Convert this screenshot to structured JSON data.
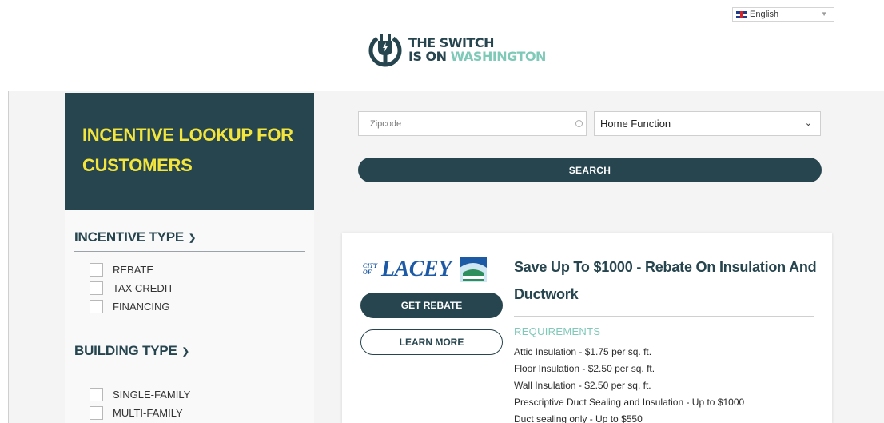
{
  "header": {
    "language": "English",
    "logo": {
      "line1": "THE SWITCH",
      "line2_a": "IS ON ",
      "line2_b": "WASHINGTON"
    }
  },
  "sidebar": {
    "title": "INCENTIVE LOOKUP FOR CUSTOMERS",
    "groups": [
      {
        "heading": "INCENTIVE TYPE",
        "options": [
          "REBATE",
          "TAX CREDIT",
          "FINANCING"
        ]
      },
      {
        "heading": "BUILDING TYPE",
        "options": [
          "SINGLE-FAMILY",
          "MULTI-FAMILY"
        ]
      }
    ]
  },
  "search": {
    "zip_placeholder": "Zipcode",
    "function_value": "Home Function",
    "button_label": "SEARCH"
  },
  "result": {
    "provider_prefix": "CITY OF",
    "provider_name": "LACEY",
    "title": "Save Up To $1000 - Rebate On Insulation And Ductwork",
    "primary_button": "GET REBATE",
    "secondary_button": "LEARN MORE",
    "requirements_label": "REQUIREMENTS",
    "requirements": [
      "Attic Insulation - $1.75 per sq. ft.",
      "Floor Insulation - $2.50 per sq. ft.",
      "Wall Insulation - $2.50 per sq. ft.",
      "Prescriptive Duct Sealing and Insulation - Up to $1000",
      "Duct sealing only - Up to $550"
    ]
  },
  "colors": {
    "brand_dark": "#26454f",
    "accent_yellow": "#f3e53b",
    "accent_teal": "#7fc9b8",
    "lacey_blue": "#1d5aa5"
  },
  "icons": {
    "logo": "power-plug-icon",
    "language_flag": "uk-flag-icon",
    "zip_loader": "spinner-icon",
    "chevron": "chevron-down-icon"
  }
}
